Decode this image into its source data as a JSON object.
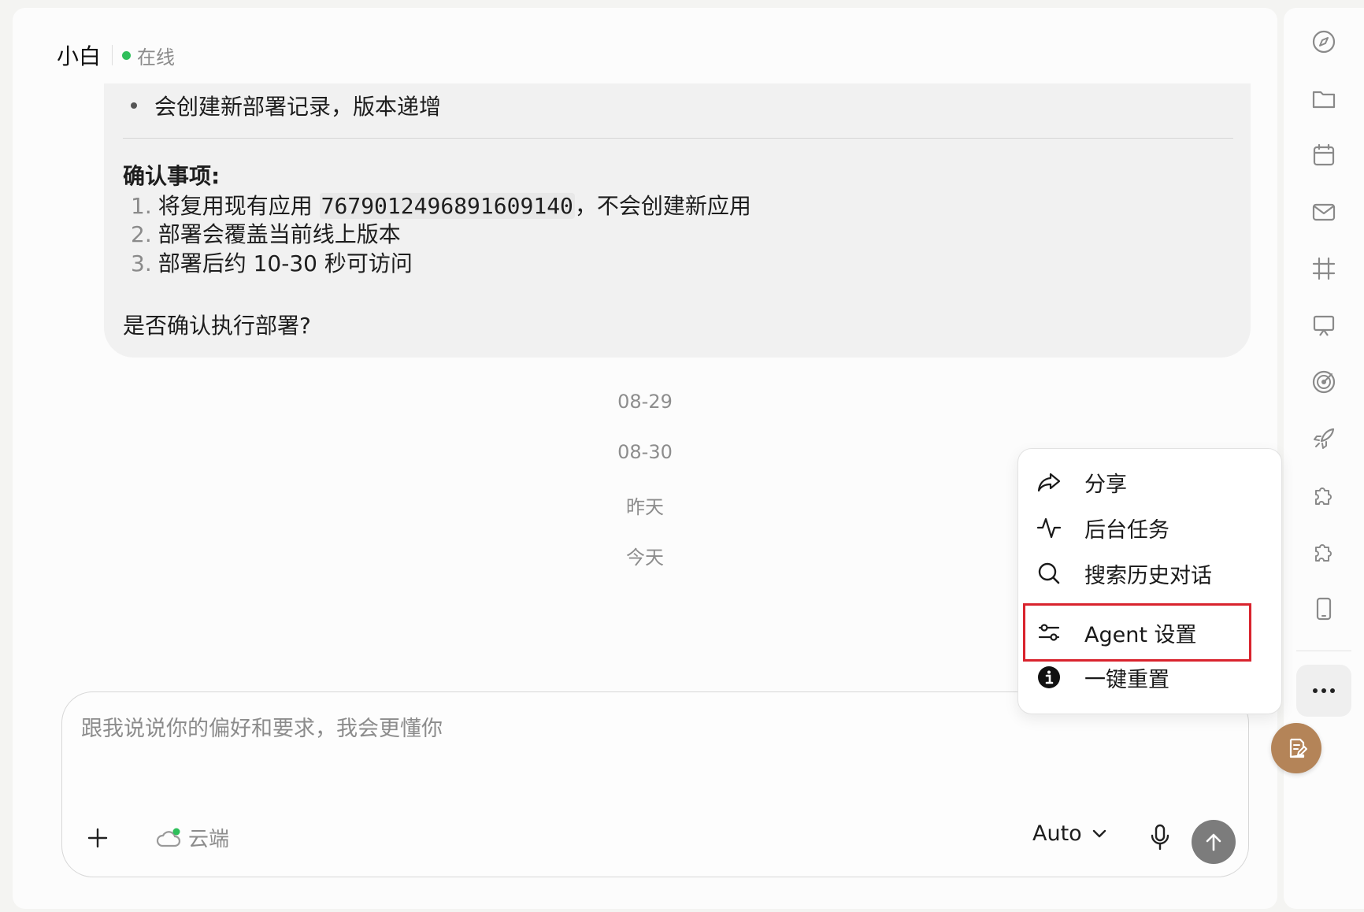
{
  "header": {
    "agent_name": "小白",
    "status": "在线",
    "status_color": "#2fbf5b"
  },
  "message": {
    "bullet_text": "会创建新部署记录，版本递增",
    "confirm_title": "确认事项:",
    "items": [
      {
        "num": "1.",
        "prefix": "将复用现有应用 ",
        "code": "7679012496891609140",
        "suffix": "，不会创建新应用"
      },
      {
        "num": "2.",
        "text": "部署会覆盖当前线上版本"
      },
      {
        "num": "3.",
        "text": "部署后约 10-30 秒可访问"
      }
    ],
    "question": "是否确认执行部署?"
  },
  "date_separators": [
    "08-29",
    "08-30",
    "昨天",
    "今天"
  ],
  "composer": {
    "placeholder": "跟我说说你的偏好和要求，我会更懂你",
    "cloud_label": "云端",
    "model": "Auto"
  },
  "menu": {
    "items": [
      {
        "label": "分享",
        "icon": "share-icon"
      },
      {
        "label": "后台任务",
        "icon": "activity-icon"
      },
      {
        "label": "搜索历史对话",
        "icon": "search-icon"
      },
      {
        "label": "Agent 设置",
        "icon": "sliders-icon",
        "highlighted": true
      },
      {
        "label": "一键重置",
        "icon": "info-icon"
      }
    ],
    "highlight_color": "#d9232d"
  },
  "rail_icons": [
    "compass-icon",
    "folder-icon",
    "calendar-icon",
    "mail-icon",
    "hash-icon",
    "presentation-icon",
    "radar-icon",
    "rocket-icon",
    "puzzle-icon",
    "puzzle-icon-2",
    "tablet-icon"
  ],
  "colors": {
    "fab": "#b48458",
    "send_button": "#7c7c7c"
  }
}
